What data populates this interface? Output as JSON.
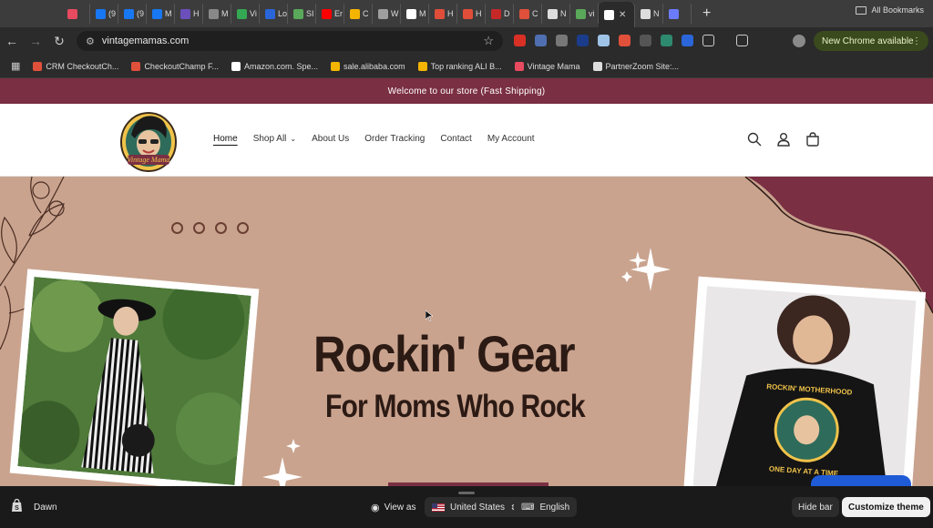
{
  "browser": {
    "tabs": [
      {
        "label": "",
        "color": "#e84a5f"
      },
      {
        "label": "(9",
        "color": "#1877f2"
      },
      {
        "label": "(9",
        "color": "#1877f2"
      },
      {
        "label": "M",
        "color": "#1877f2"
      },
      {
        "label": "H",
        "color": "#6b4fbb"
      },
      {
        "label": "M",
        "color": "#888888"
      },
      {
        "label": "Vi",
        "color": "#34a853"
      },
      {
        "label": "Lo",
        "color": "#2a66d9"
      },
      {
        "label": "SI",
        "color": "#5aa85a"
      },
      {
        "label": "Er",
        "color": "#ff0000"
      },
      {
        "label": "C",
        "color": "#f4b400"
      },
      {
        "label": "W",
        "color": "#9e9e9e"
      },
      {
        "label": "M",
        "color": "#ffffff"
      },
      {
        "label": "H",
        "color": "#e04e39"
      },
      {
        "label": "H",
        "color": "#e04e39"
      },
      {
        "label": "D",
        "color": "#c62828"
      },
      {
        "label": "C",
        "color": "#e0503a"
      },
      {
        "label": "N",
        "color": "#dddddd"
      },
      {
        "label": "vi",
        "color": "#5aa85a"
      }
    ],
    "active_tab": {
      "label": "",
      "color": "#ffffff"
    },
    "after_tabs": [
      {
        "label": "N",
        "color": "#dddddd"
      },
      {
        "label": "",
        "color": "#6b7bff"
      }
    ],
    "url": "vintagemamas.com",
    "update_label": "New Chrome available",
    "bookmarks": [
      {
        "label": "CRM CheckoutCh...",
        "color": "#e0503a"
      },
      {
        "label": "CheckoutChamp F...",
        "color": "#e0503a"
      },
      {
        "label": "Amazon.com. Spe...",
        "color": "#ffffff"
      },
      {
        "label": "sale.alibaba.com",
        "color": "#f4b400"
      },
      {
        "label": "Top ranking ALI B...",
        "color": "#f4b400"
      },
      {
        "label": "Vintage Mama",
        "color": "#e84a5f"
      },
      {
        "label": "PartnerZoom Site:...",
        "color": "#dddddd"
      }
    ],
    "all_bookmarks": "All Bookmarks"
  },
  "store": {
    "announcement": "Welcome to our store (Fast Shipping)",
    "logo_text": "Vintage Mama",
    "nav": [
      {
        "label": "Home",
        "active": true
      },
      {
        "label": "Shop All",
        "dropdown": true
      },
      {
        "label": "About Us"
      },
      {
        "label": "Order Tracking"
      },
      {
        "label": "Contact"
      },
      {
        "label": "My Account"
      }
    ],
    "hero": {
      "title": "Rockin' Gear",
      "subtitle": "For Moms Who Rock",
      "shirt_text_top": "ROCKIN' MOTHERHOOD",
      "shirt_text_bottom": "ONE DAY AT A TIME",
      "colors": {
        "bg": "#c9a38e",
        "accent": "#7a2f43",
        "text": "#2c1a14"
      }
    }
  },
  "adminbar": {
    "theme": "Dawn",
    "view_as": "View as",
    "country": "United States",
    "language": "English",
    "hide_bar": "Hide bar",
    "customize": "Customize theme"
  }
}
